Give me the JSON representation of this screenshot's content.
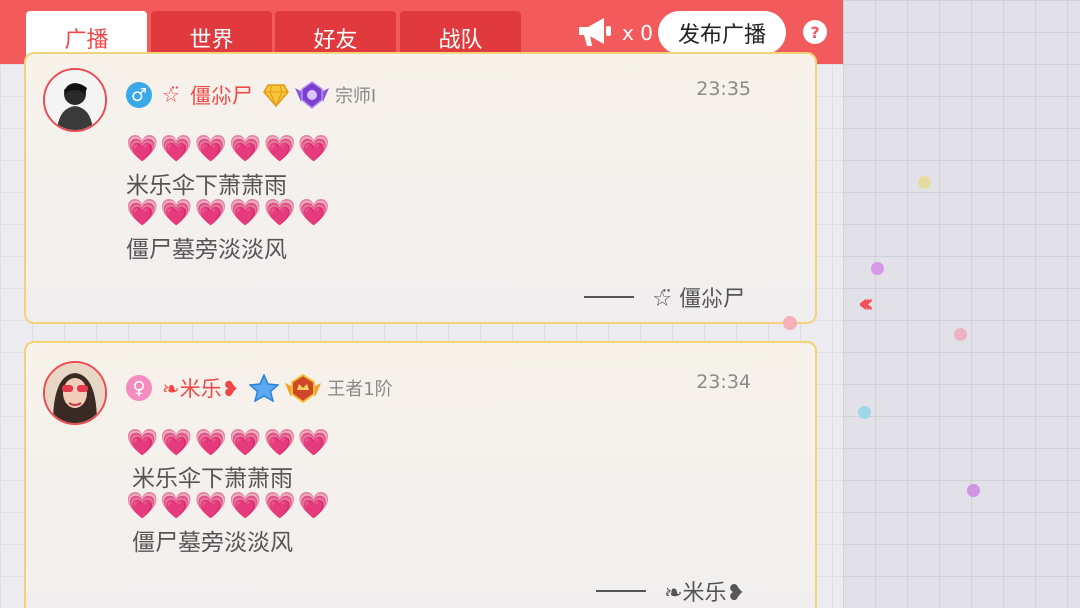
{
  "tabs": [
    {
      "label": "广播",
      "active": true
    },
    {
      "label": "世界",
      "active": false
    },
    {
      "label": "好友",
      "active": false
    },
    {
      "label": "战队",
      "active": false
    }
  ],
  "header": {
    "horn_icon": "megaphone-icon",
    "horn_count": "x 0",
    "publish_label": "发布广播",
    "help_label": "?"
  },
  "colors": {
    "accent": "#f35a5c",
    "tab_dark": "#e03a3e",
    "nickname": "#f04848",
    "heart": "#ff1e8c",
    "card_border": "#f3d27a"
  },
  "messages": [
    {
      "gender_symbol": "♂",
      "gender_color": "#3ba8e8",
      "nick_deco": "☆̈",
      "nickname": "僵尛尸",
      "rank_text": "宗师I",
      "time": "23:35",
      "hearts_1": "💗💗💗💗💗💗",
      "line_1": "米乐伞下萧萧雨",
      "hearts_2": "💗💗💗💗💗💗",
      "line_2": "僵尸墓旁淡淡风",
      "signature": "☆̈   僵尛尸"
    },
    {
      "gender_symbol": "♀",
      "gender_color": "#f58cc0",
      "nick_deco": "",
      "nickname": "❧米乐❥",
      "rank_text": "王者1阶",
      "time": "23:34",
      "hearts_1": "💗💗💗💗💗💗",
      "line_1": "米乐伞下萧萧雨",
      "hearts_2": "💗💗💗💗💗💗",
      "line_2": "僵尸墓旁淡淡风",
      "signature": "❧米乐❥"
    }
  ]
}
